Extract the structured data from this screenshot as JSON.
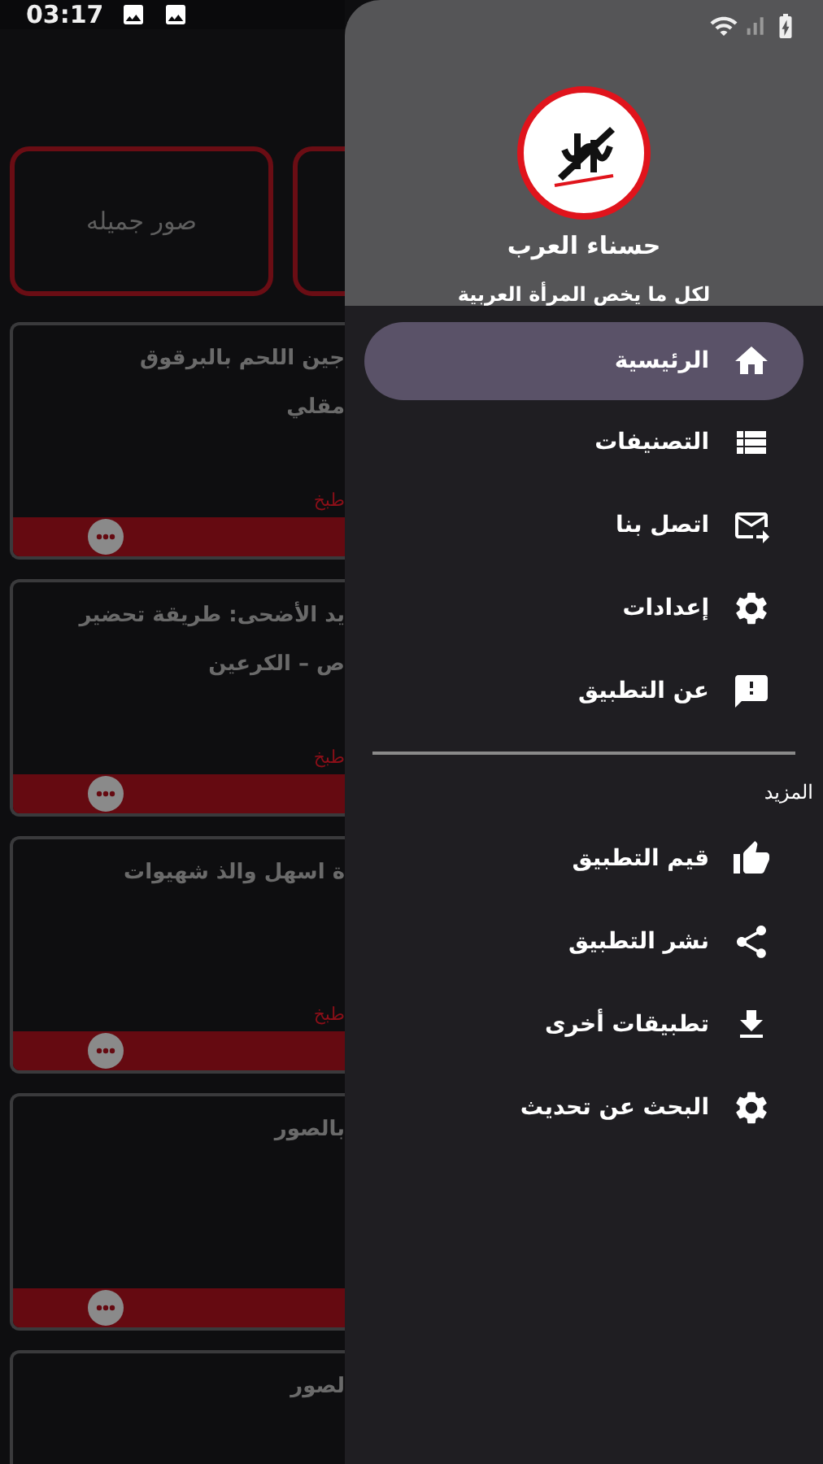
{
  "status_bar": {
    "time": "03:17"
  },
  "tiles": [
    {
      "kind": "labeled",
      "label": "صور جميله"
    },
    {
      "kind": "blank"
    }
  ],
  "cards": [
    {
      "title_lines": [
        "جين اللحم بالبرقوق",
        "مقلي"
      ],
      "tag": "طبخ",
      "footer": true
    },
    {
      "title_lines": [
        "يد الأضحى: طريقة تحضير",
        "ص – الكرعين"
      ],
      "tag": "طبخ",
      "footer": true
    },
    {
      "title_lines": [
        "ة اسهل والذ شهيوات"
      ],
      "tag": "طبخ",
      "footer": true
    },
    {
      "title_lines": [
        "بالصور"
      ],
      "footer": true
    },
    {
      "title_lines": [
        "لصور"
      ]
    }
  ],
  "drawer": {
    "title": "حسناء العرب",
    "subtitle": "لكل ما يخص المرأة العربية",
    "items": [
      {
        "kind": "home",
        "label": "الرئيسية",
        "selected": true
      },
      {
        "kind": "list",
        "label": "التصنيفات",
        "selected": false
      },
      {
        "kind": "mail",
        "label": "اتصل بنا",
        "selected": false
      },
      {
        "kind": "settings",
        "label": "إعدادات",
        "selected": false
      },
      {
        "kind": "feedback",
        "label": "عن التطبيق",
        "selected": false
      }
    ],
    "section_label": "المزيد",
    "more_items": [
      {
        "kind": "thumb",
        "label": "قيم التطبيق",
        "selected": false
      },
      {
        "kind": "share",
        "label": "نشر التطبيق",
        "selected": false
      },
      {
        "kind": "download",
        "label": "تطبيقات أخرى",
        "selected": false
      },
      {
        "kind": "settings",
        "label": "البحث عن تحديث",
        "selected": false
      }
    ]
  }
}
